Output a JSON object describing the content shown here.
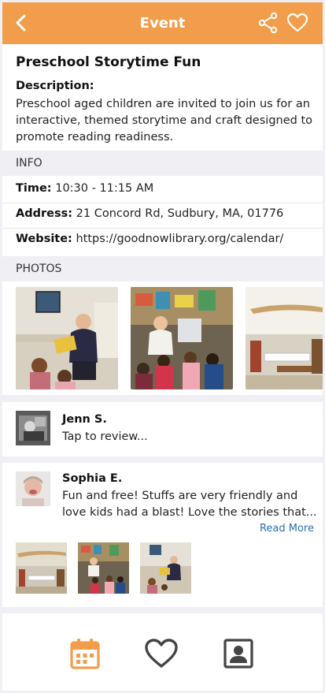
{
  "header": {
    "title": "Event",
    "back_icon": "chevron-left-icon",
    "share_icon": "share-icon",
    "favorite_icon": "heart-outline-icon",
    "background": "#f19d4b"
  },
  "event": {
    "title": "Preschool Storytime Fun",
    "description_label": "Description:",
    "description": "Preschool aged children are invited to join us for an interactive, themed storytime and craft designed to promote reading readiness."
  },
  "info": {
    "section_label": "INFO",
    "time_label": "Time:",
    "time_value": "10:30 - 11:15 AM",
    "address_label": "Address:",
    "address_value": "21 Concord Rd, Sudbury, MA, 01776",
    "website_label": "Website:",
    "website_value": "https://goodnowlibrary.org/calendar/"
  },
  "photos": {
    "section_label": "PHOTOS"
  },
  "reviews": [
    {
      "name": "Jenn S.",
      "text": "Tap to review..."
    },
    {
      "name": "Sophia E.",
      "text_line1": "Fun and free! Stuffs are very friendly and",
      "text_line2": "love kids had a blast! Love the stories that...",
      "read_more": "Read More"
    }
  ],
  "tabbar": {
    "tabs": [
      {
        "icon": "calendar-icon",
        "active": true,
        "color": "#f19d4b"
      },
      {
        "icon": "heart-outline-icon",
        "active": false,
        "color": "#444444"
      },
      {
        "icon": "profile-card-icon",
        "active": false,
        "color": "#444444"
      }
    ]
  }
}
